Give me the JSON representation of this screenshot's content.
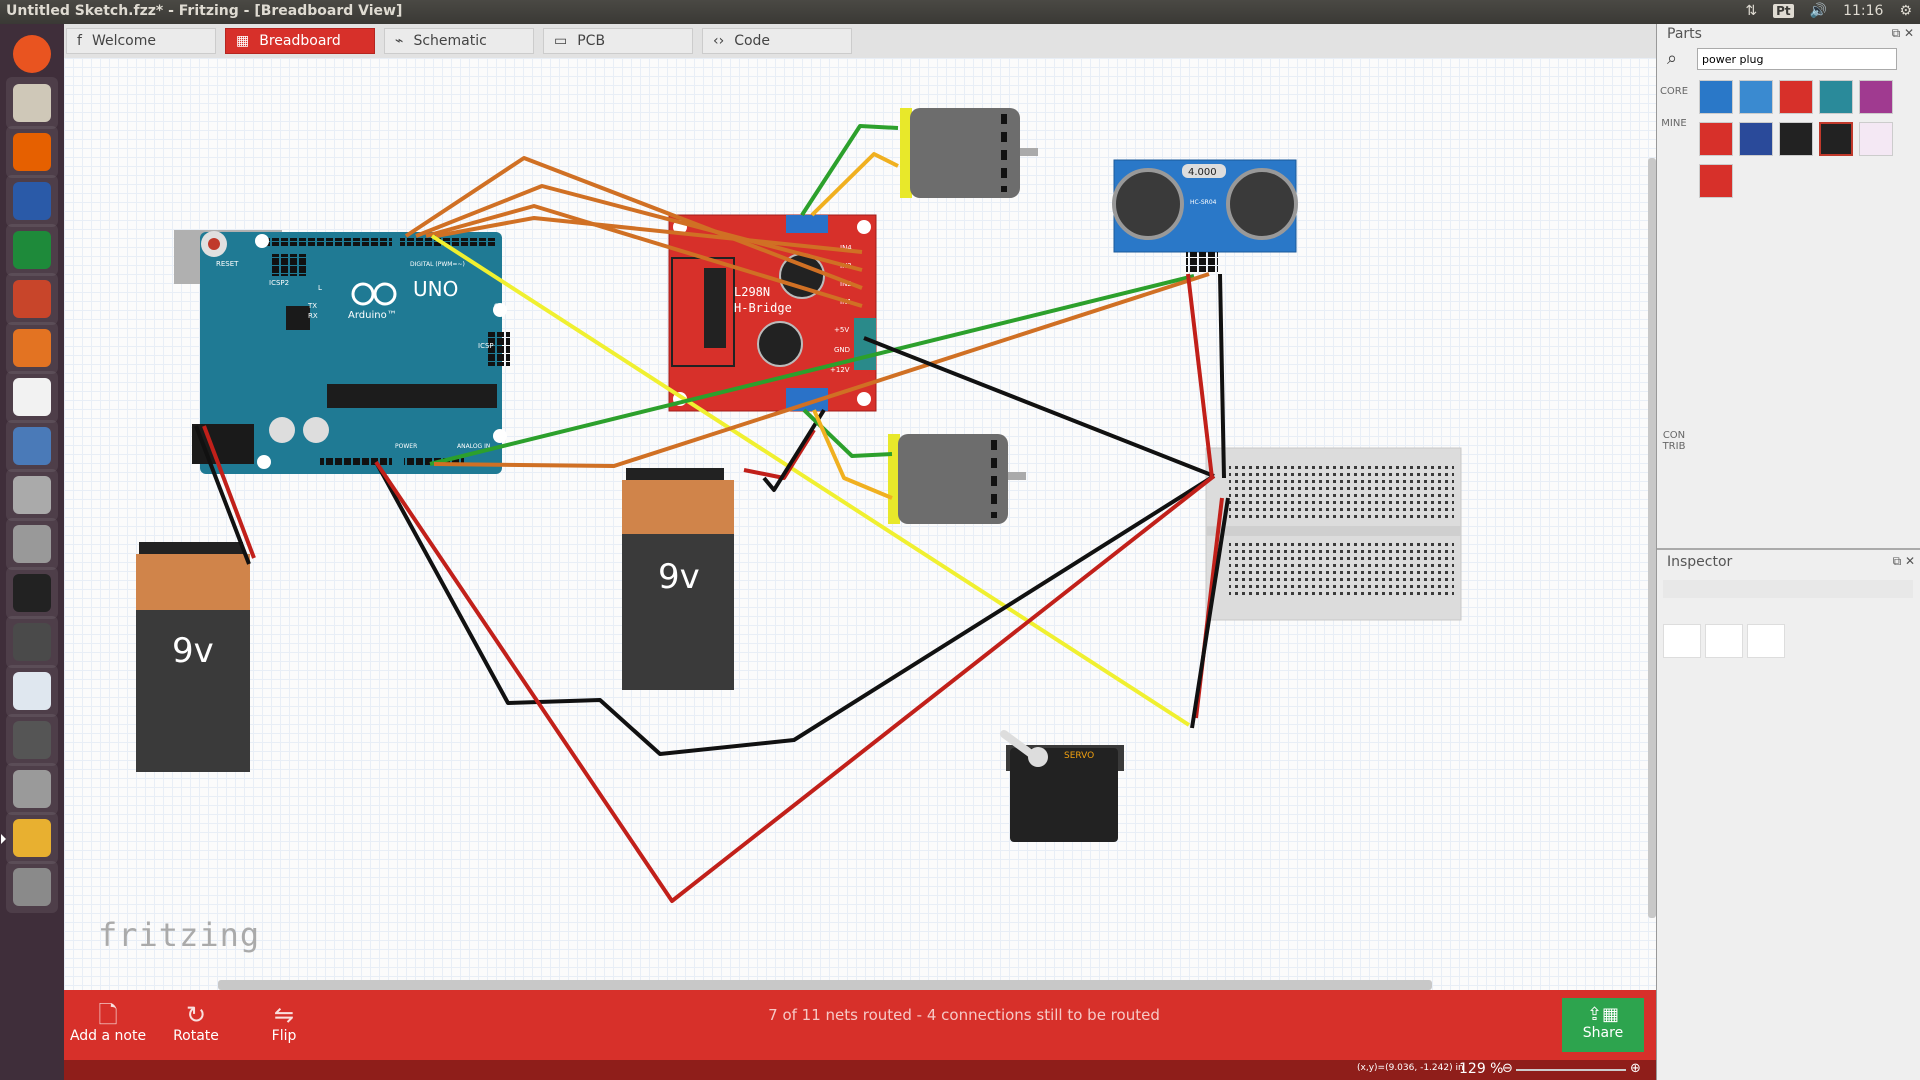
{
  "window": {
    "title": "Untitled Sketch.fzz* - Fritzing - [Breadboard View]"
  },
  "system_tray": {
    "keyboard": "Pt",
    "time": "11:16",
    "icons": [
      "sort-icon",
      "keyboard-icon",
      "volume-icon",
      "gear-icon"
    ]
  },
  "launcher": {
    "icons": [
      "ubuntu-dash-icon",
      "files-icon",
      "firefox-icon",
      "writer-icon",
      "calc-icon",
      "impress-icon",
      "software-center-icon",
      "amazon-icon",
      "settings-icon",
      "disk-icon",
      "drive-icon",
      "terminal-icon",
      "sublime-icon",
      "chrome-icon",
      "updater-icon",
      "help-icon",
      "fritzing-icon",
      "trash-icon"
    ]
  },
  "tabs": [
    {
      "label": "Welcome",
      "icon": "welcome-icon"
    },
    {
      "label": "Breadboard",
      "icon": "breadboard-icon",
      "selected": true
    },
    {
      "label": "Schematic",
      "icon": "schematic-icon"
    },
    {
      "label": "PCB",
      "icon": "pcb-icon"
    },
    {
      "label": "Code",
      "icon": "code-icon"
    }
  ],
  "canvas": {
    "watermark": "fritzing",
    "arduino": {
      "reset": "RESET",
      "icsp2": "ICSP2",
      "uno": "UNO",
      "brand": "Arduino™",
      "l": "L",
      "tx": "TX",
      "rx": "RX",
      "icsp": "ICSP",
      "digital": "DIGITAL (PWM=~)",
      "power": "POWER",
      "analog": "ANALOG IN",
      "on": "ON"
    },
    "hbridge": {
      "name1": "L298N",
      "name2": "H-Bridge",
      "pins": [
        "IN4",
        "IN3",
        "IN2",
        "IN1",
        "+5V",
        "GND",
        "+12V"
      ]
    },
    "battery_left": {
      "label": "9v"
    },
    "battery_mid": {
      "label": "9v"
    },
    "sensor": {
      "display": "4.000",
      "model": "HC-SR04"
    },
    "servo": {
      "label": "SERVO"
    }
  },
  "toolbar": {
    "add_note": "Add a note",
    "rotate": "Rotate",
    "flip": "Flip",
    "share": "Share"
  },
  "routing_status": "7 of 11 nets routed - 4 connections still to be routed",
  "status": {
    "coords": "(x,y)=(9.036, -1.242) in",
    "zoom": "129 %"
  },
  "parts_panel": {
    "title": "Parts",
    "search_value": "power plug",
    "bins": [
      "CORE",
      "MINE",
      "CON TRIB"
    ]
  },
  "inspector": {
    "title": "Inspector"
  },
  "colors": {
    "accent": "#d7302a",
    "share": "#2da44e",
    "arduino": "#1f7a94",
    "hbridge": "#d7302a",
    "sensor": "#2a78c8"
  }
}
